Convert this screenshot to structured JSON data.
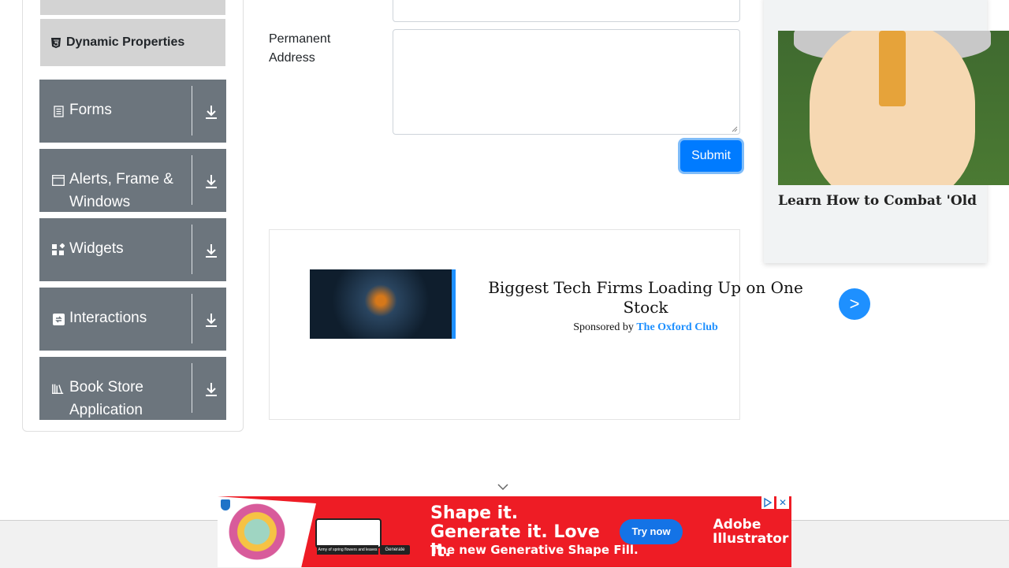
{
  "sidebar": {
    "dynamic_properties": "Dynamic Properties",
    "groups": [
      {
        "label": "Forms",
        "icon": "form-icon"
      },
      {
        "label": "Alerts, Frame & Windows",
        "icon": "window-icon"
      },
      {
        "label": "Widgets",
        "icon": "widgets-icon"
      },
      {
        "label": "Interactions",
        "icon": "interactions-icon"
      },
      {
        "label": "Book Store Application",
        "icon": "books-icon"
      }
    ]
  },
  "form": {
    "permanent_address_label": "Permanent Address",
    "submit_label": "Submit"
  },
  "ad_mid": {
    "title": "Biggest Tech Firms Loading Up on One Stock",
    "sponsored_prefix": "Sponsored by",
    "sponsor": "The Oxford Club",
    "next_label": ">"
  },
  "ad_right": {
    "headline": "Learn How to Combat 'Old"
  },
  "ad_banner": {
    "headline": "Shape it. Generate it. Love it.",
    "subline": "The new Generative Shape Fill.",
    "cta": "Try now",
    "brand": "Adobe Illustrator",
    "card_caption": "Army of spring flowers and leaves",
    "generate_label": "Generate"
  },
  "colors": {
    "sidebar_group_bg": "#6c757d",
    "submit_bg": "#007bff",
    "banner_bg": "#ee1c25"
  }
}
